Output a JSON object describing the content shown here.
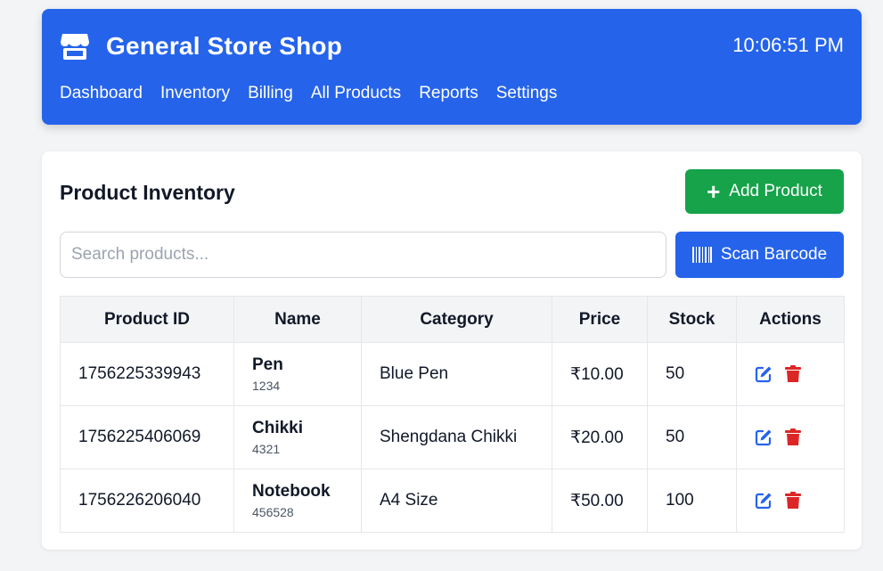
{
  "header": {
    "title": "General Store Shop",
    "clock": "10:06:51 PM",
    "nav": [
      "Dashboard",
      "Inventory",
      "Billing",
      "All Products",
      "Reports",
      "Settings"
    ]
  },
  "inventory": {
    "title": "Product Inventory",
    "add_label": "Add Product",
    "search_placeholder": "Search products...",
    "scan_label": "Scan Barcode",
    "columns": [
      "Product ID",
      "Name",
      "Category",
      "Price",
      "Stock",
      "Actions"
    ],
    "rows": [
      {
        "id": "1756225339943",
        "name": "Pen",
        "code": "1234",
        "category": "Blue Pen",
        "price": "₹10.00",
        "stock": "50"
      },
      {
        "id": "1756225406069",
        "name": "Chikki",
        "code": "4321",
        "category": "Shengdana Chikki",
        "price": "₹20.00",
        "stock": "50"
      },
      {
        "id": "1756226206040",
        "name": "Notebook",
        "code": "456528",
        "category": "A4 Size",
        "price": "₹50.00",
        "stock": "100"
      }
    ]
  },
  "colors": {
    "primary": "#2563eb",
    "success": "#16a34a",
    "danger": "#dc2626",
    "background": "#f3f4f6"
  },
  "icons": {
    "brand": "store-icon",
    "add": "plus-icon",
    "scan": "barcode-icon",
    "edit": "edit-icon",
    "delete": "trash-icon"
  }
}
